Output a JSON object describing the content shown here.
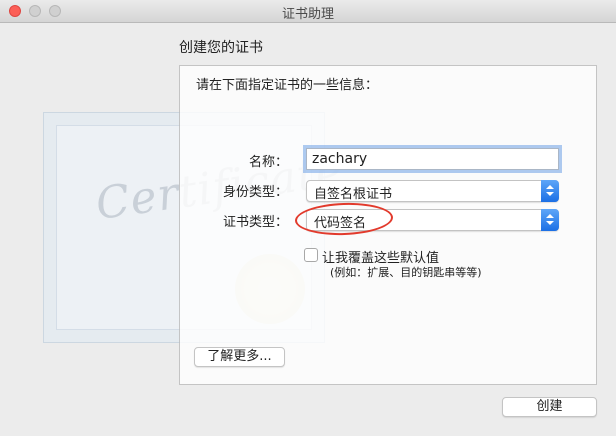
{
  "window": {
    "title": "证书助理"
  },
  "page": {
    "heading": "创建您的证书",
    "prompt": "请在下面指定证书的一些信息：",
    "certificate_watermark": "Certificate"
  },
  "form": {
    "name_label": "名称：",
    "name_value": "zachary",
    "identity_type_label": "身份类型：",
    "identity_type_value": "自签名根证书",
    "certificate_type_label": "证书类型：",
    "certificate_type_value": "代码签名",
    "override_label": "让我覆盖这些默认值",
    "override_hint": "(例如：扩展、目的钥匙串等等)",
    "override_checked": false
  },
  "buttons": {
    "learn_more": "了解更多...",
    "create": "创建"
  },
  "colors": {
    "annotation": "#e23a2c",
    "close": "#fc5f57",
    "accent": "#1b6fe5",
    "focus_ring": "#6ea0e6"
  },
  "icons": {
    "popup_indicator": "chevron-updown-icon"
  }
}
